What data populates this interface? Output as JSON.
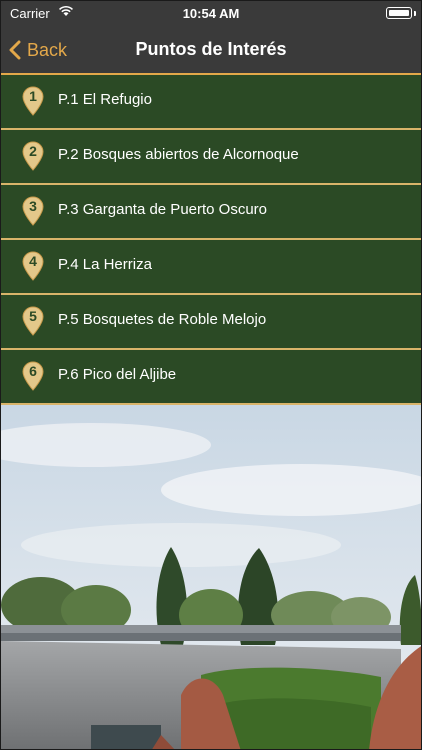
{
  "status_bar": {
    "carrier": "Carrier",
    "time": "10:54 AM"
  },
  "nav": {
    "back_label": "Back",
    "title": "Puntos de Interés"
  },
  "colors": {
    "accent": "#e3a84a",
    "list_bg": "#2b4a25",
    "separator": "#d9b46a",
    "bar_bg": "#3a3a3a"
  },
  "icons": {
    "back": "chevron-left-icon",
    "poi": "map-pin-icon",
    "wifi": "wifi-icon",
    "battery": "battery-icon"
  },
  "poi_items": [
    {
      "number": "1",
      "label": "P.1 El Refugio"
    },
    {
      "number": "2",
      "label": "P.2 Bosques abiertos de Alcornoque"
    },
    {
      "number": "3",
      "label": "P.3 Garganta de Puerto Oscuro"
    },
    {
      "number": "4",
      "label": "P.4 La Herriza"
    },
    {
      "number": "5",
      "label": "P.5 Bosquetes de Roble Melojo"
    },
    {
      "number": "6",
      "label": "P.6 Pico del Aljibe"
    }
  ]
}
